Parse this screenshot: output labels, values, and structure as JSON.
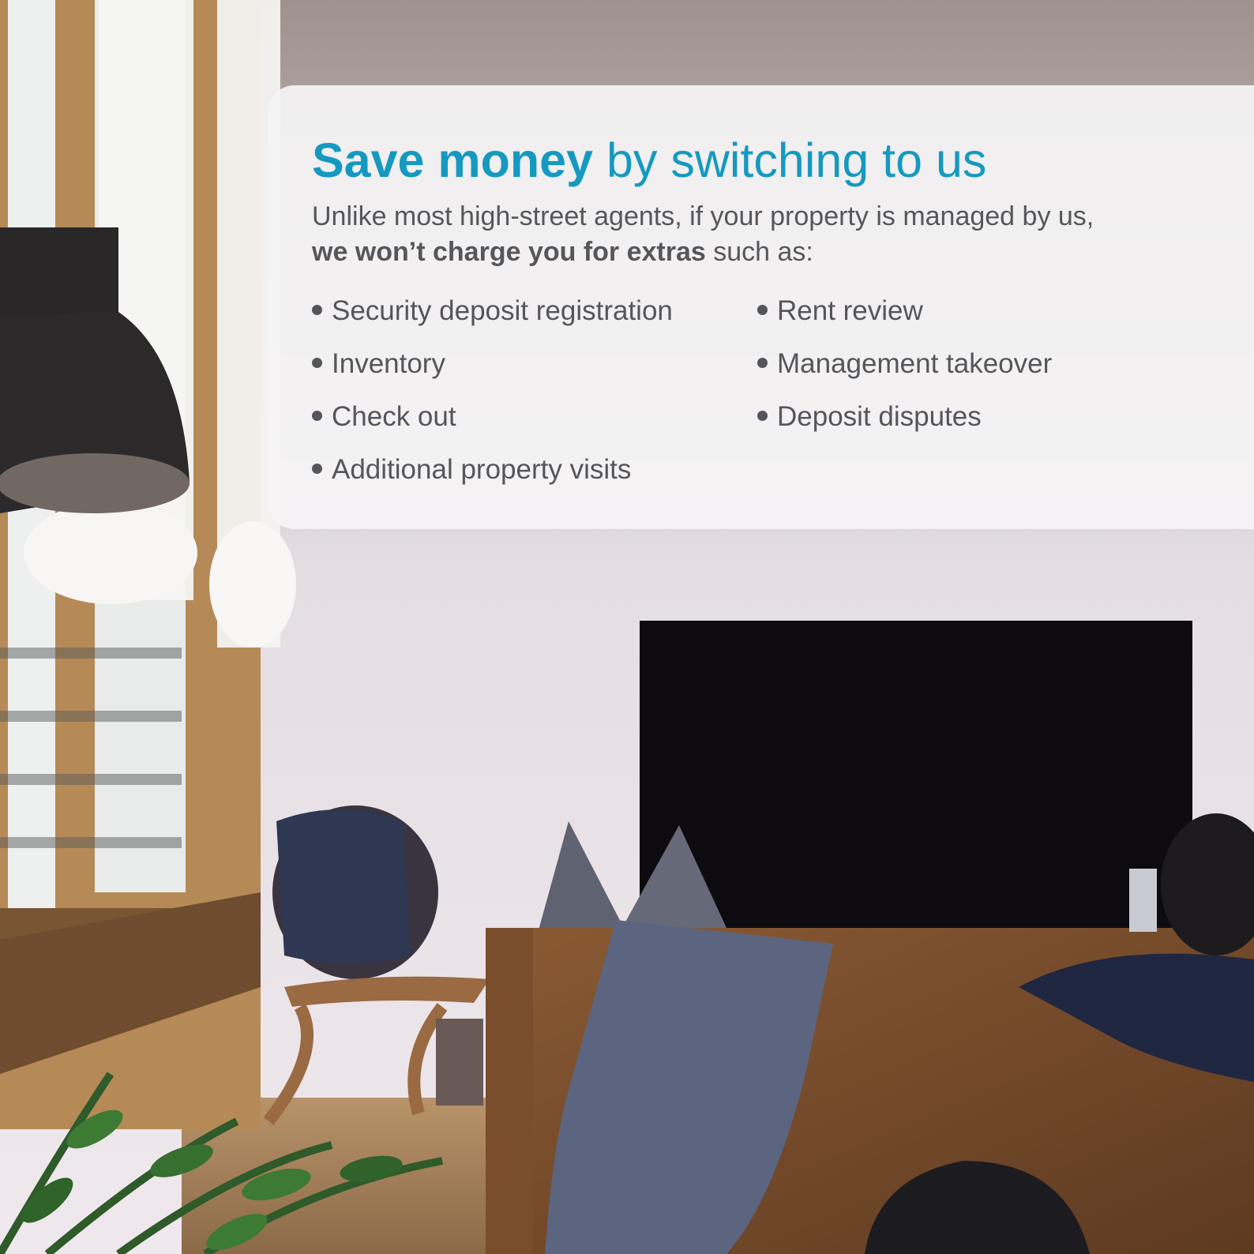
{
  "headline": {
    "bold": "Save money",
    "rest": "by switching to us"
  },
  "intro": {
    "line1": "Unlike most high-street agents, if your property is managed by us,",
    "bold": "we won’t charge you for extras",
    "rest": "such as:"
  },
  "benefits": {
    "left": [
      "Security deposit registration",
      "Inventory",
      "Check out",
      "Additional property visits"
    ],
    "right": [
      "Rent review",
      "Management takeover",
      "Deposit disputes"
    ]
  },
  "colors": {
    "accent": "#1599c0",
    "body_text": "#55565a",
    "card": "#f5f4f5"
  }
}
